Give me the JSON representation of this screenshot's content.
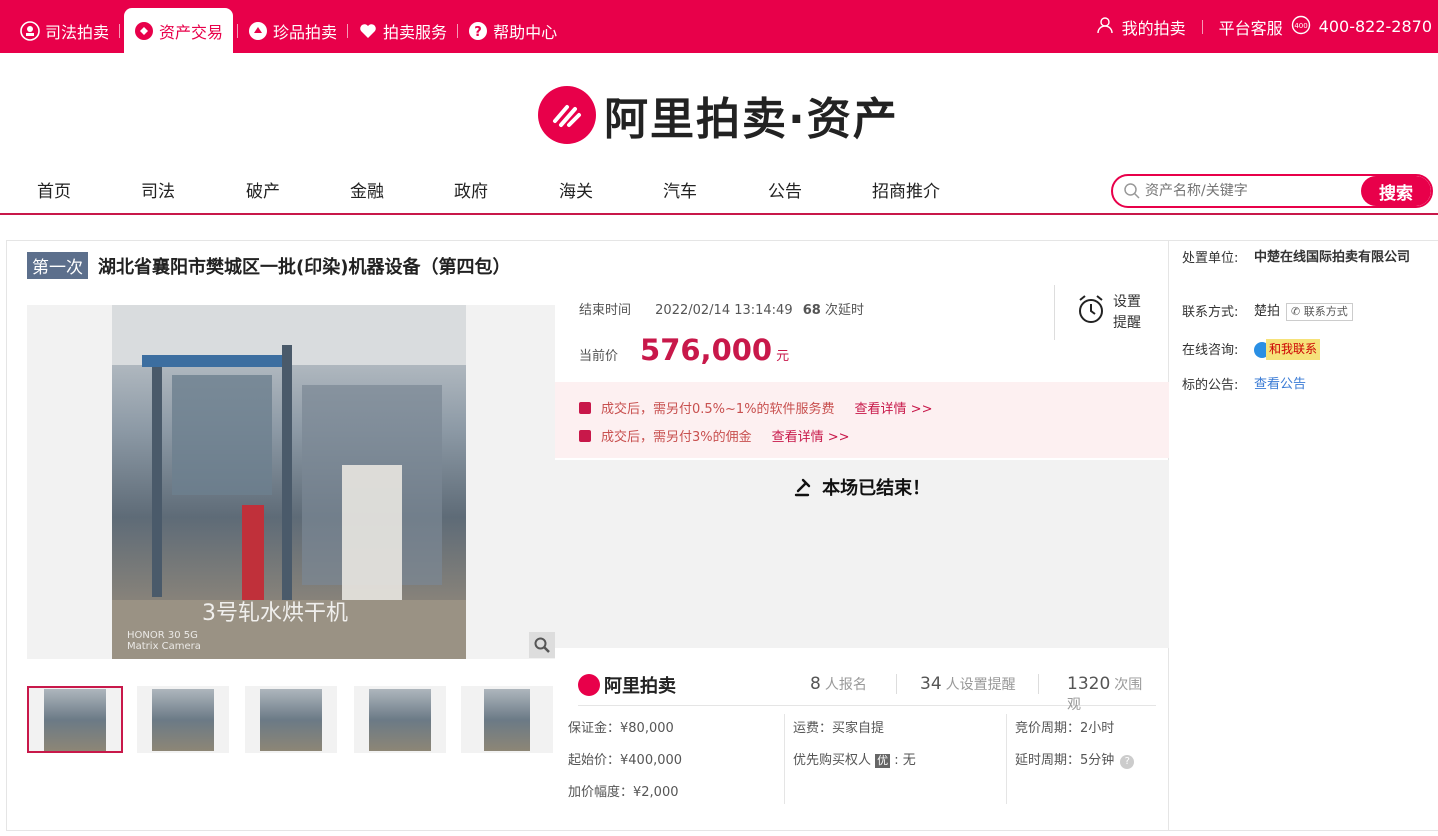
{
  "topbar": {
    "nav": [
      {
        "label": "司法拍卖",
        "icon": "court-icon",
        "active": false
      },
      {
        "label": "资产交易",
        "icon": "asset-icon",
        "active": true
      },
      {
        "label": "珍品拍卖",
        "icon": "treasure-icon",
        "active": false
      },
      {
        "label": "拍卖服务",
        "icon": "heart-icon",
        "active": false
      },
      {
        "label": "帮助中心",
        "icon": "help-icon",
        "active": false
      }
    ],
    "my_auction": "我的拍卖",
    "service_label": "平台客服",
    "service_phone": "400-822-2870"
  },
  "logo": {
    "text": "阿里拍卖·资产"
  },
  "mainnav": [
    "首页",
    "司法",
    "破产",
    "金融",
    "政府",
    "海关",
    "汽车",
    "公告",
    "招商推介"
  ],
  "search": {
    "placeholder": "资产名称/关键字",
    "button": "搜索"
  },
  "item": {
    "round": "第一次",
    "title": "湖北省襄阳市樊城区一批(印染)机器设备（第四包）",
    "image_caption": "3号轧水烘干机",
    "camera_line1": "HONOR 30 5G",
    "camera_line2": "Matrix Camera",
    "end_label": "结束时间",
    "end_time": "2022/02/14 13:14:49",
    "delay_count": "68",
    "delay_suffix": "次延时",
    "price_label": "当前价",
    "price": "576,000",
    "price_unit": "元",
    "remind_line1": "设置",
    "remind_line2": "提醒",
    "fee1": "成交后，需另付0.5%~1%的软件服务费",
    "fee1_link": "查看详情 >>",
    "fee2": "成交后，需另付3%的佣金",
    "fee2_link": "查看详情 >>",
    "ended_msg": "本场已结束！"
  },
  "stats": {
    "logo": "阿里拍卖",
    "signups": "8",
    "signups_label": "人报名",
    "reminders": "34",
    "reminders_label": "人设置提醒",
    "views": "1320",
    "views_label": "次围观"
  },
  "params": {
    "deposit": "保证金：¥80,000",
    "start_price": "起始价：¥400,000",
    "increment": "加价幅度：¥2,000",
    "shipping": "运费：买家自提",
    "priority_label": "优先购买权人",
    "priority_badge": "优",
    "priority_value": ": 无",
    "bid_period": "竞价周期：2小时",
    "delay_period": "延时周期：5分钟"
  },
  "side": {
    "org_label": "处置单位:",
    "org_value": "中楚在线国际拍卖有限公司",
    "contact_label": "联系方式:",
    "contact_value": "楚拍",
    "contact_btn": "联系方式",
    "chat_label": "在线咨询:",
    "chat_btn": "和我联系",
    "notice_label": "标的公告:",
    "notice_link": "查看公告"
  },
  "colors": {
    "brand": "#e8004a",
    "price": "#c8184a",
    "badge": "#5c6f8c"
  }
}
